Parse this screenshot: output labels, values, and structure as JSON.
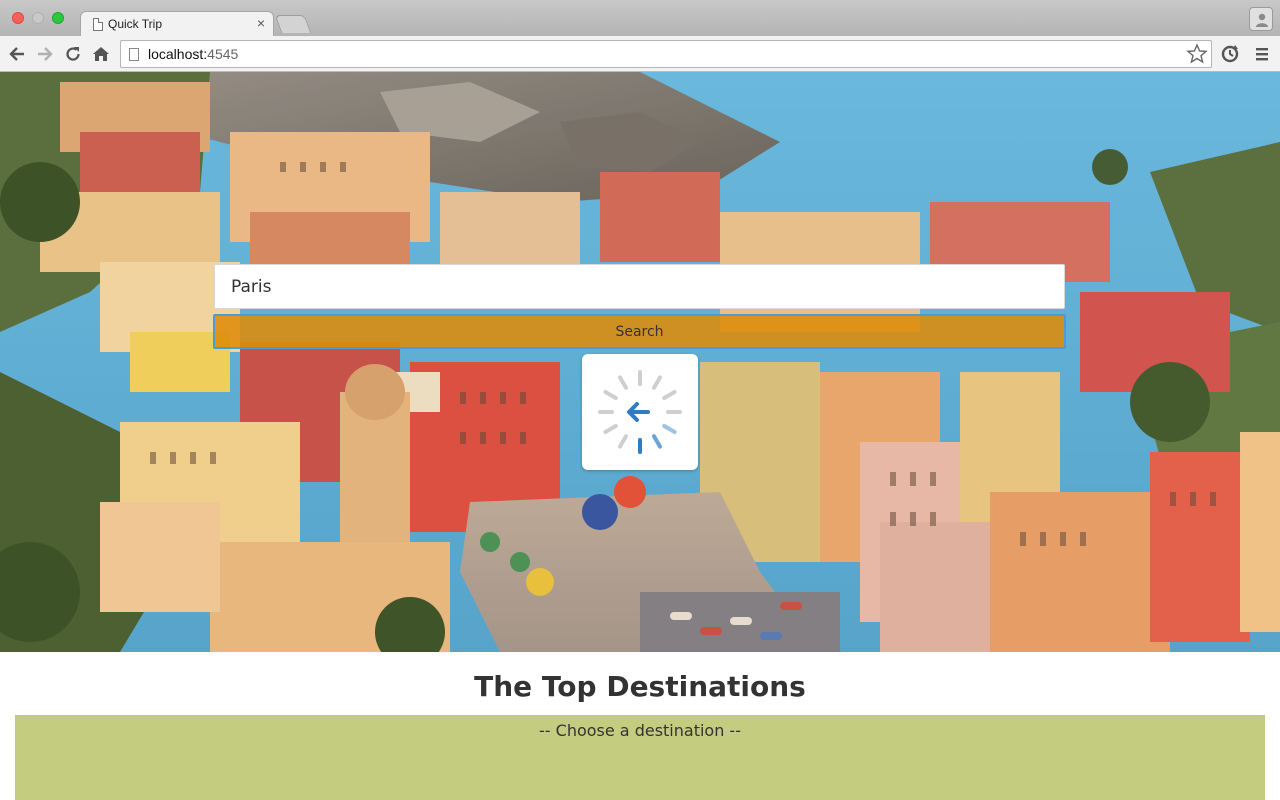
{
  "browser": {
    "tab_title": "Quick Trip",
    "tab_close": "×",
    "url_host": "localhost:",
    "url_port": "4545"
  },
  "search": {
    "value": "Paris",
    "button_label": "Search"
  },
  "hero": {
    "image_alt": "Colorful coastal village"
  },
  "destinations": {
    "title": "The Top Destinations",
    "select_value": "-- Choose a destination --"
  }
}
